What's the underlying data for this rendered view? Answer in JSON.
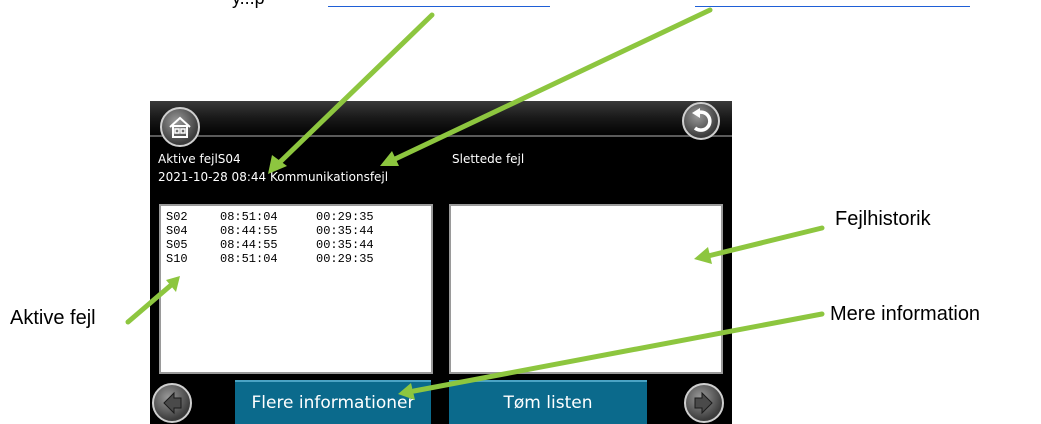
{
  "top_links": {
    "left_prefix": "y...p",
    "left": "",
    "right": ""
  },
  "screen": {
    "left_title": "Aktive fejlS04",
    "left_subtitle": "2021-10-28 08:44 Kommunikationsfejl",
    "right_title": "Slettede fejl",
    "active_faults": [
      {
        "code": "S02",
        "time1": "08:51:04",
        "time2": "00:29:35"
      },
      {
        "code": "S04",
        "time1": "08:44:55",
        "time2": "00:35:44"
      },
      {
        "code": "S05",
        "time1": "08:44:55",
        "time2": "00:35:44"
      },
      {
        "code": "S10",
        "time1": "08:51:04",
        "time2": "00:29:35"
      }
    ],
    "buttons": {
      "more_info": "Flere informationer",
      "clear": "Tøm listen"
    }
  },
  "callouts": {
    "history": "Fejlhistorik",
    "active": "Aktive fejl",
    "more_info": "Mere information"
  },
  "colors": {
    "arrow": "#8dc63f",
    "button": "#0b6a8c",
    "link": "#1f5fd6"
  },
  "icons": [
    "home-icon",
    "back-icon",
    "arrow-left-icon",
    "arrow-right-icon"
  ]
}
